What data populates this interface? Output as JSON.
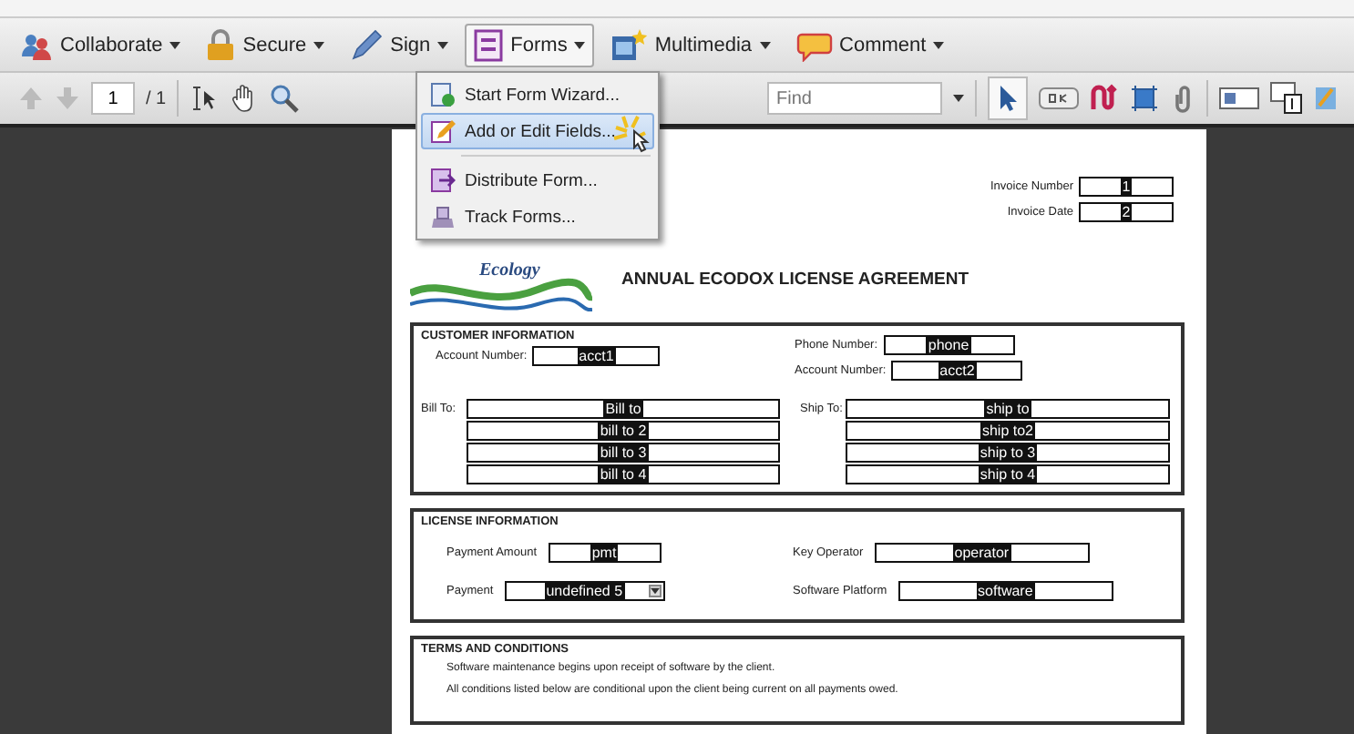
{
  "task_bar": {
    "tasks": [
      {
        "label": "Collaborate",
        "selected": false
      },
      {
        "label": "Secure",
        "selected": false
      },
      {
        "label": "Sign",
        "selected": false
      },
      {
        "label": "Forms",
        "selected": true
      },
      {
        "label": "Multimedia",
        "selected": false
      },
      {
        "label": "Comment",
        "selected": false
      }
    ]
  },
  "nav_bar": {
    "page": "1",
    "total": "/ 1",
    "find_placeholder": "Find"
  },
  "forms_menu": {
    "items": [
      {
        "label": "Start Form Wizard...",
        "highlighted": false
      },
      {
        "label": "Add or Edit Fields...",
        "highlighted": true
      },
      {
        "label": "Distribute Form...",
        "highlighted": false
      },
      {
        "label": "Track Forms...",
        "highlighted": false
      }
    ]
  },
  "document": {
    "logo_text": "Ecology",
    "title": "ANNUAL ECODOX LICENSE AGREEMENT",
    "header_fields": [
      {
        "label": "Invoice Number",
        "value": "1"
      },
      {
        "label": "Invoice Date",
        "value": "2"
      }
    ],
    "customer": {
      "heading": "CUSTOMER INFORMATION",
      "left_fields": [
        {
          "label": "Account Number:",
          "value": "acct1"
        }
      ],
      "right_fields": [
        {
          "label": "Phone Number:",
          "value": "phone"
        },
        {
          "label": "Account Number:",
          "value": "acct2"
        }
      ],
      "bill_to": {
        "label": "Bill To:",
        "values": [
          "Bill to",
          "bill to 2",
          "bill to 3",
          "bill to 4"
        ]
      },
      "ship_to": {
        "label": "Ship To:",
        "values": [
          "ship to",
          "ship to2",
          "ship to 3",
          "ship to 4"
        ]
      }
    },
    "license": {
      "heading": "LICENSE INFORMATION",
      "fields": [
        {
          "label": "Payment Amount",
          "value": "pmt",
          "kind": "text"
        },
        {
          "label": "Key Operator",
          "value": "operator",
          "kind": "text"
        },
        {
          "label": "Payment",
          "value": "undefined 5",
          "kind": "dropdown"
        },
        {
          "label": "Software Platform",
          "value": "software",
          "kind": "text"
        }
      ]
    },
    "terms": {
      "heading": "TERMS AND CONDITIONS",
      "lines": [
        "Software maintenance begins upon receipt of software by the client.",
        "All conditions listed below are conditional upon the client being current on all payments owed."
      ]
    }
  }
}
